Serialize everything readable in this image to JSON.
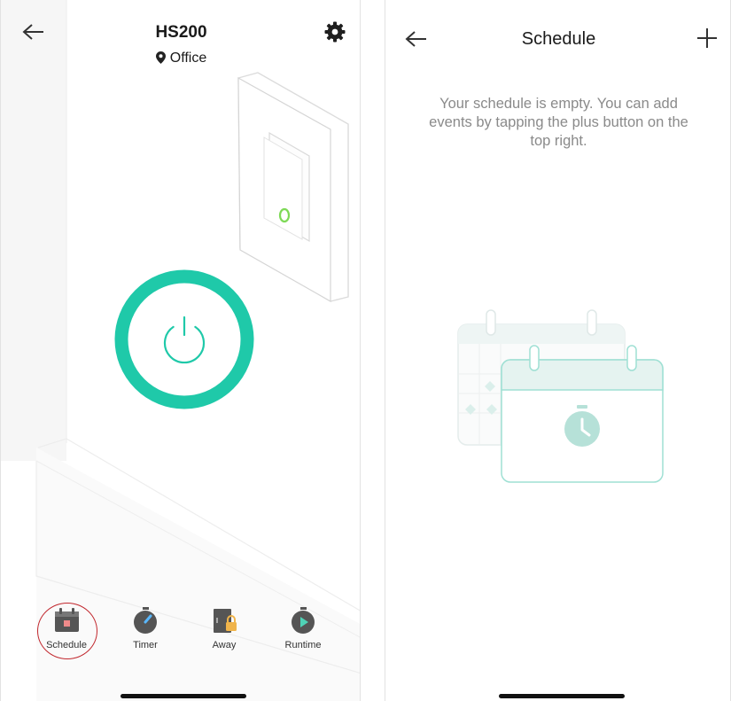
{
  "left_screen": {
    "device_name": "HS200",
    "location": "Office",
    "icons": {
      "back": "back-arrow-icon",
      "settings": "gear-icon",
      "location": "location-pin-icon",
      "power": "power-icon"
    },
    "accent_color": "#1fc9a9",
    "tabs": [
      {
        "label": "Schedule",
        "icon": "calendar-icon"
      },
      {
        "label": "Timer",
        "icon": "stopwatch-icon"
      },
      {
        "label": "Away",
        "icon": "away-lock-icon"
      },
      {
        "label": "Runtime",
        "icon": "runtime-play-icon"
      }
    ]
  },
  "right_screen": {
    "title": "Schedule",
    "empty_message": "Your schedule is empty. You can add events by tapping the plus button on the top right.",
    "icons": {
      "back": "back-arrow-icon",
      "add": "plus-icon",
      "illustration": "calendar-empty-illustration"
    }
  }
}
